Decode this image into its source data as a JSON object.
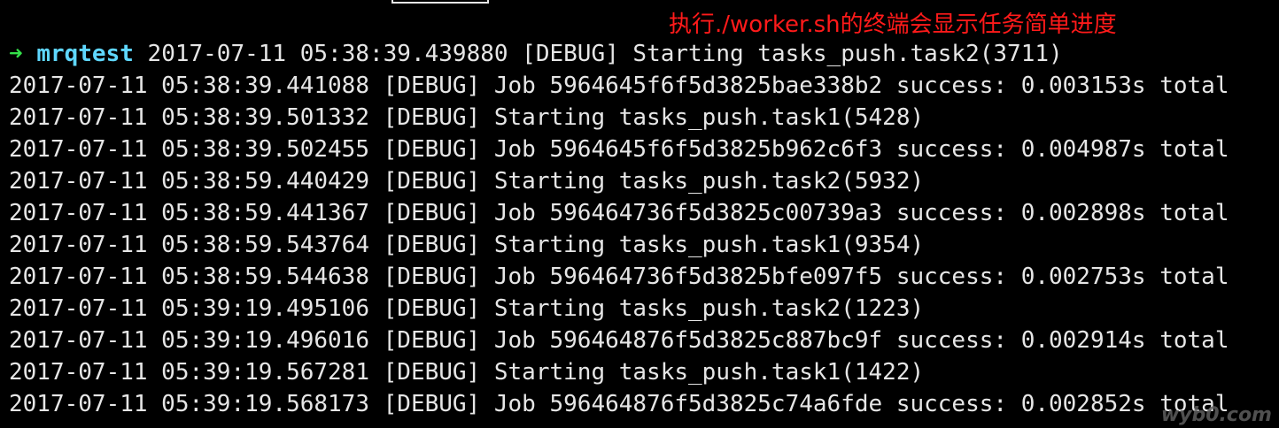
{
  "annotation": "执行./worker.sh的终端会显示任务简单进度",
  "prompt": {
    "arrow": "➜",
    "directory": "mrqtest",
    "rest": " 2017-07-11 05:38:39.439880 [DEBUG] Starting tasks_push.task2(3711)"
  },
  "log_lines": [
    "2017-07-11 05:38:39.441088 [DEBUG] Job 5964645f6f5d3825bae338b2 success: 0.003153s total",
    "2017-07-11 05:38:39.501332 [DEBUG] Starting tasks_push.task1(5428)",
    "2017-07-11 05:38:39.502455 [DEBUG] Job 5964645f6f5d3825b962c6f3 success: 0.004987s total",
    "2017-07-11 05:38:59.440429 [DEBUG] Starting tasks_push.task2(5932)",
    "2017-07-11 05:38:59.441367 [DEBUG] Job 596464736f5d3825c00739a3 success: 0.002898s total",
    "2017-07-11 05:38:59.543764 [DEBUG] Starting tasks_push.task1(9354)",
    "2017-07-11 05:38:59.544638 [DEBUG] Job 596464736f5d3825bfe097f5 success: 0.002753s total",
    "2017-07-11 05:39:19.495106 [DEBUG] Starting tasks_push.task2(1223)",
    "2017-07-11 05:39:19.496016 [DEBUG] Job 596464876f5d3825c887bc9f success: 0.002914s total",
    "2017-07-11 05:39:19.567281 [DEBUG] Starting tasks_push.task1(1422)",
    "2017-07-11 05:39:19.568173 [DEBUG] Job 596464876f5d3825c74a6fde success: 0.002852s total"
  ],
  "watermark": "wyb0.com",
  "colors": {
    "background": "#000000",
    "text": "#e6e6e6",
    "prompt_arrow": "#34e04a",
    "prompt_directory": "#5fd7ff",
    "annotation": "#ff1a1a"
  }
}
